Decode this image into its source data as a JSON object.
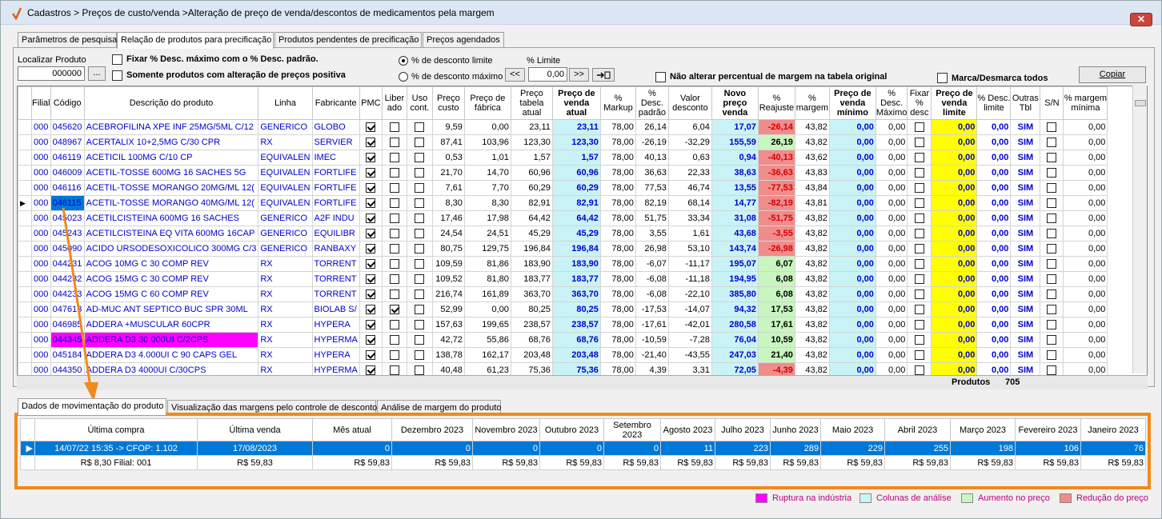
{
  "window": {
    "title": "Cadastros > Preços de custo/venda >Alteração de preço de venda/descontos de medicamentos pela margem",
    "close": "✕"
  },
  "tabs": [
    "Parâmetros de pesquisa",
    "Relação de produtos para precificação",
    "Produtos pendentes de precificação",
    "Preços agendados"
  ],
  "toolbar": {
    "find_label": "Localizar Produto",
    "find_value": "000000",
    "find_btn": "...",
    "fix_label": "Fixar % Desc. máximo com o % Desc. padrão.",
    "only_label": "Somente produtos com alteração de preços positiva",
    "radio1": "% de desconto limite",
    "radio2": "% de desconto máximo",
    "limit_label": "% Limite",
    "limit_value": "0,00",
    "prev": "<<",
    "next": ">>",
    "no_alter": "Não alterar percentual de margem na tabela original",
    "mark_all": "Marca/Desmarca todos",
    "copy": "Copiar"
  },
  "grid": {
    "headers": [
      "Filial",
      "Código",
      "Descrição do produto",
      "Linha",
      "Fabricante",
      "PMC",
      "Liber ado",
      "Uso cont.",
      "Preço custo",
      "Preço de fábrica",
      "Preço tabela atual",
      "Preço de venda atual",
      "% Markup",
      "% Desc. padrão",
      "Valor desconto",
      "Novo preço venda",
      "% Reajuste",
      "% margem",
      "Preço de venda mínimo",
      "% Desc. Máximo",
      "Fixar % desc",
      "Preço de venda limite",
      "% Desc. limite",
      "Outras Tbl",
      "S/N",
      "% margem mínima"
    ],
    "rows": [
      [
        "000",
        "045620",
        "ACEBROFILINA XPE INF 25MG/5ML C/12",
        "GENERICO",
        "GLOBO",
        1,
        0,
        0,
        "9,59",
        "0,00",
        "23,11",
        "23,11",
        "78,00",
        "26,14",
        "6,04",
        "17,07",
        "-26,14",
        "43,82",
        "0,00",
        "0,00",
        0,
        "0,00",
        "0,00",
        "SIM",
        0,
        "0,00"
      ],
      [
        "000",
        "048967",
        "ACERTALIX 10+2,5MG C/30 CPR",
        "RX",
        "SERVIER",
        1,
        0,
        0,
        "87,41",
        "103,96",
        "123,30",
        "123,30",
        "78,00",
        "-26,19",
        "-32,29",
        "155,59",
        "26,19",
        "43,82",
        "0,00",
        "0,00",
        0,
        "0,00",
        "0,00",
        "SIM",
        0,
        "0,00"
      ],
      [
        "000",
        "046119",
        "ACETICIL 100MG C/10 CP",
        "EQUIVALEN",
        "IMEC",
        1,
        0,
        0,
        "0,53",
        "1,01",
        "1,57",
        "1,57",
        "78,00",
        "40,13",
        "0,63",
        "0,94",
        "-40,13",
        "43,62",
        "0,00",
        "0,00",
        0,
        "0,00",
        "0,00",
        "SIM",
        0,
        "0,00"
      ],
      [
        "000",
        "046009",
        "ACETIL-TOSSE 600MG 16 SACHES 5G",
        "EQUIVALEN",
        "FORTLIFE",
        1,
        0,
        0,
        "21,70",
        "14,70",
        "60,96",
        "60,96",
        "78,00",
        "36,63",
        "22,33",
        "38,63",
        "-36,63",
        "43,83",
        "0,00",
        "0,00",
        0,
        "0,00",
        "0,00",
        "SIM",
        0,
        "0,00"
      ],
      [
        "000",
        "046116",
        "ACETIL-TOSSE MORANGO 20MG/ML 12(",
        "EQUIVALEN",
        "FORTLIFE",
        1,
        0,
        0,
        "7,61",
        "7,70",
        "60,29",
        "60,29",
        "78,00",
        "77,53",
        "46,74",
        "13,55",
        "-77,53",
        "43,84",
        "0,00",
        "0,00",
        0,
        "0,00",
        "0,00",
        "SIM",
        0,
        "0,00"
      ],
      [
        "000",
        "046115",
        "ACETIL-TOSSE MORANGO 40MG/ML 12(",
        "EQUIVALEN",
        "FORTLIFE",
        1,
        0,
        0,
        "8,30",
        "8,30",
        "82,91",
        "82,91",
        "78,00",
        "82,19",
        "68,14",
        "14,77",
        "-82,19",
        "43,81",
        "0,00",
        "0,00",
        0,
        "0,00",
        "0,00",
        "SIM",
        0,
        "0,00"
      ],
      [
        "000",
        "045023",
        "ACETILCISTEINA 600MG 16 SACHES",
        "GENERICO",
        "A2F INDU",
        1,
        0,
        0,
        "17,46",
        "17,98",
        "64,42",
        "64,42",
        "78,00",
        "51,75",
        "33,34",
        "31,08",
        "-51,75",
        "43,82",
        "0,00",
        "0,00",
        0,
        "0,00",
        "0,00",
        "SIM",
        0,
        "0,00"
      ],
      [
        "000",
        "045243",
        "ACETILCISTEINA EQ VITA 600MG 16CAP",
        "GENERICO",
        "EQUILIBR",
        1,
        0,
        0,
        "24,54",
        "24,51",
        "45,29",
        "45,29",
        "78,00",
        "3,55",
        "1,61",
        "43,68",
        "-3,55",
        "43,82",
        "0,00",
        "0,00",
        0,
        "0,00",
        "0,00",
        "SIM",
        0,
        "0,00"
      ],
      [
        "000",
        "045090",
        "ACIDO URSODESOXICOLICO 300MG C/3",
        "GENERICO",
        "RANBAXY",
        1,
        0,
        0,
        "80,75",
        "129,75",
        "196,84",
        "196,84",
        "78,00",
        "26,98",
        "53,10",
        "143,74",
        "-26,98",
        "43,82",
        "0,00",
        "0,00",
        0,
        "0,00",
        "0,00",
        "SIM",
        0,
        "0,00"
      ],
      [
        "000",
        "044231",
        "ACOG 10MG C 30 COMP REV",
        "RX",
        "TORRENT",
        1,
        0,
        0,
        "109,59",
        "81,86",
        "183,90",
        "183,90",
        "78,00",
        "-6,07",
        "-11,17",
        "195,07",
        "6,07",
        "43,82",
        "0,00",
        "0,00",
        0,
        "0,00",
        "0,00",
        "SIM",
        0,
        "0,00"
      ],
      [
        "000",
        "044232",
        "ACOG 15MG C 30 COMP REV",
        "RX",
        "TORRENT",
        1,
        0,
        0,
        "109,52",
        "81,80",
        "183,77",
        "183,77",
        "78,00",
        "-6,08",
        "-11,18",
        "194,95",
        "6,08",
        "43,82",
        "0,00",
        "0,00",
        0,
        "0,00",
        "0,00",
        "SIM",
        0,
        "0,00"
      ],
      [
        "000",
        "044233",
        "ACOG 15MG C 60 COMP REV",
        "RX",
        "TORRENT",
        1,
        0,
        0,
        "216,74",
        "161,89",
        "363,70",
        "363,70",
        "78,00",
        "-6,08",
        "-22,10",
        "385,80",
        "6,08",
        "43,82",
        "0,00",
        "0,00",
        0,
        "0,00",
        "0,00",
        "SIM",
        0,
        "0,00"
      ],
      [
        "000",
        "047613",
        "AD-MUC ANT SEPTICO BUC SPR 30ML",
        "RX",
        "BIOLAB S/",
        1,
        1,
        0,
        "52,99",
        "0,00",
        "80,25",
        "80,25",
        "78,00",
        "-17,53",
        "-14,07",
        "94,32",
        "17,53",
        "43,82",
        "0,00",
        "0,00",
        0,
        "0,00",
        "0,00",
        "SIM",
        0,
        "0,00"
      ],
      [
        "000",
        "046985",
        "ADDERA +MUSCULAR 60CPR",
        "RX",
        "HYPERA",
        1,
        0,
        0,
        "157,63",
        "199,65",
        "238,57",
        "238,57",
        "78,00",
        "-17,61",
        "-42,01",
        "280,58",
        "17,61",
        "43,82",
        "0,00",
        "0,00",
        0,
        "0,00",
        "0,00",
        "SIM",
        0,
        "0,00"
      ],
      [
        "000",
        "044345",
        "ADDERA D3 30 000UI C/2CPS",
        "RX",
        "HYPERMA",
        1,
        0,
        0,
        "42,72",
        "55,86",
        "68,76",
        "68,76",
        "78,00",
        "-10,59",
        "-7,28",
        "76,04",
        "10,59",
        "43,82",
        "0,00",
        "0,00",
        0,
        "0,00",
        "0,00",
        "SIM",
        0,
        "0,00"
      ],
      [
        "000",
        "045184",
        "ADDERA D3 4.000UI C 90 CAPS GEL",
        "RX",
        "HYPERA",
        1,
        0,
        0,
        "138,78",
        "162,17",
        "203,48",
        "203,48",
        "78,00",
        "-21,40",
        "-43,55",
        "247,03",
        "21,40",
        "43,82",
        "0,00",
        "0,00",
        0,
        "0,00",
        "0,00",
        "SIM",
        0,
        "0,00"
      ],
      [
        "000",
        "044350",
        "ADDERA D3 4000UI C/30CPS",
        "RX",
        "HYPERMA",
        1,
        0,
        0,
        "40,48",
        "61,23",
        "75,36",
        "75,36",
        "78,00",
        "4,39",
        "3,31",
        "72,05",
        "-4,39",
        "43,82",
        "0,00",
        "0,00",
        0,
        "0,00",
        "0,00",
        "SIM",
        0,
        "0,00"
      ]
    ],
    "footer_label": "Produtos",
    "footer_value": "705"
  },
  "lower_tabs": [
    "Dados de movimentação do produto",
    "Visualização das margens pelo controle de desconto",
    "Análise de margem do produto"
  ],
  "movement": {
    "headers": [
      "Última compra",
      "Última venda",
      "Mês atual",
      "Dezembro 2023",
      "Novembro 2023",
      "Outubro 2023",
      "Setembro 2023",
      "Agosto 2023",
      "Julho 2023",
      "Junho 2023",
      "Maio 2023",
      "Abril 2023",
      "Março 2023",
      "Fevereiro 2023",
      "Janeiro 2023"
    ],
    "row1": [
      "14/07/22 15:35 -> CFOP: 1.102",
      "17/08/2023",
      "0",
      "0",
      "0",
      "0",
      "0",
      "11",
      "223",
      "289",
      "229",
      "255",
      "198",
      "106",
      "76"
    ],
    "row2": [
      "R$ 8,30 Filial: 001",
      "R$ 59,83",
      "R$ 59,83",
      "R$ 59,83",
      "R$ 59,83",
      "R$ 59,83",
      "R$ 59,83",
      "R$ 59,83",
      "R$ 59,83",
      "R$ 59,83",
      "R$ 59,83",
      "R$ 59,83",
      "R$ 59,83",
      "R$ 59,83",
      "R$ 59,83"
    ]
  },
  "legend": [
    {
      "label": "Ruptura na indústria",
      "color": "#ff00ff"
    },
    {
      "label": "Colunas de análise",
      "color": "#c9f3f7"
    },
    {
      "label": "Aumento no preço",
      "color": "#c8f5c0"
    },
    {
      "label": "Redução do preço",
      "color": "#f08c8c"
    }
  ]
}
